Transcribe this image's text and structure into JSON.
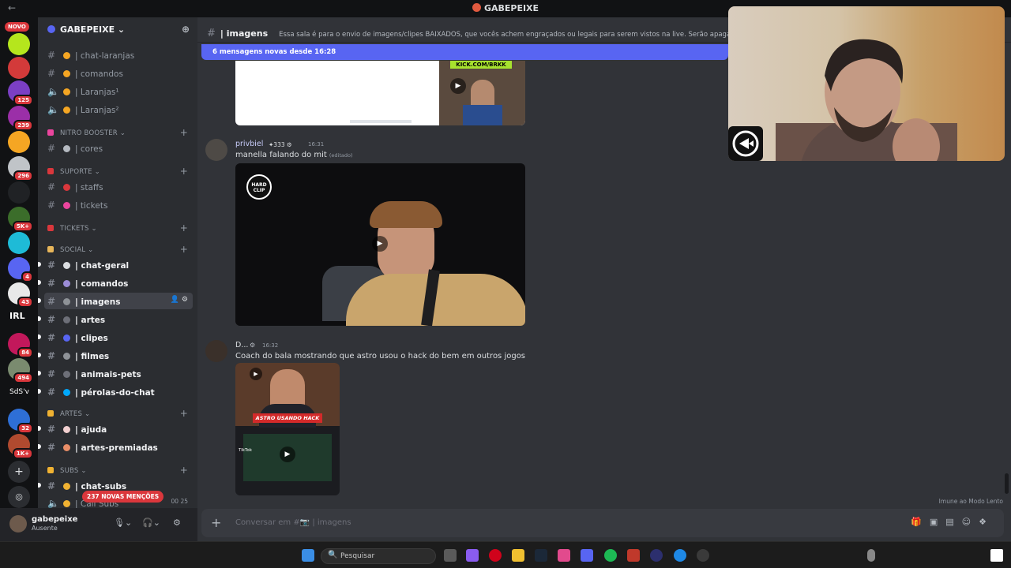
{
  "window": {
    "title": "GABEPEIXE",
    "back_label": "←"
  },
  "rail": {
    "novo_label": "NOVO",
    "servers": [
      {
        "name": "server-lime",
        "badge": "",
        "color": "#b5e61d"
      },
      {
        "name": "server-red-logo",
        "badge": "",
        "color": "#d33a3a"
      },
      {
        "name": "server-purple-1",
        "badge": "125",
        "color": "#7b3fc4"
      },
      {
        "name": "server-purple-2",
        "badge": "239",
        "color": "#9b2fa8"
      },
      {
        "name": "server-emoji",
        "badge": "",
        "color": "#f5a623"
      },
      {
        "name": "server-face",
        "badge": "296",
        "color": "#c0c4c8"
      },
      {
        "name": "server-diamond",
        "badge": "",
        "color": "#202225"
      },
      {
        "name": "server-frog",
        "badge": "5K+",
        "color": "#3b6d2a"
      },
      {
        "name": "server-rsmp",
        "badge": "",
        "color": "#1ebbd7"
      },
      {
        "name": "server-space",
        "badge": "4",
        "color": "#5865f2"
      },
      {
        "name": "server-white",
        "badge": "43",
        "color": "#e8e8e8"
      },
      {
        "name": "server-irl",
        "badge": "",
        "color": "#111214"
      },
      {
        "name": "server-pink",
        "badge": "84",
        "color": "#c2185b"
      },
      {
        "name": "server-anime",
        "badge": "494",
        "color": "#7a8b6f"
      },
      {
        "name": "server-sdsv",
        "badge": "",
        "color": "#111214"
      },
      {
        "name": "server-blue",
        "badge": "32",
        "color": "#2e6fd6"
      },
      {
        "name": "server-art",
        "badge": "1K+",
        "color": "#b04a2f"
      }
    ],
    "irl_label": "IRL",
    "sdsv_label": "SdS'v"
  },
  "sidebar": {
    "guild_name": "GABEPEIXE ⌄",
    "channels_top": [
      {
        "label": "| chat-laranjas"
      },
      {
        "label": "| comandos"
      },
      {
        "label": "| Laranjas¹"
      },
      {
        "label": "| Laranjas²"
      }
    ],
    "cat_nitro": "NITRO BOOSTER ⌄",
    "ch_cores": "| cores",
    "cat_suporte": "SUPORTE ⌄",
    "ch_staffs": "| staffs",
    "ch_tickets": "| tickets",
    "cat_tickets": "TICKETS ⌄",
    "cat_social": "SOCIAL ⌄",
    "social_channels": [
      {
        "label": "| chat-geral"
      },
      {
        "label": "| comandos"
      },
      {
        "label": "| imagens"
      },
      {
        "label": "| artes"
      },
      {
        "label": "| clipes"
      },
      {
        "label": "| filmes"
      },
      {
        "label": "| animais-pets"
      },
      {
        "label": "| pérolas-do-chat"
      }
    ],
    "cat_artes": "ARTES ⌄",
    "ch_ajuda": "| ajuda",
    "ch_artes_premiadas": "| artes-premiadas",
    "cat_subs": "SUBS ⌄",
    "ch_chat_subs": "| chat-subs",
    "ch_call_subs": "| Call Subs",
    "call_counts": "00  25",
    "mentions": "237 NOVAS MENÇÕES"
  },
  "user": {
    "name": "gabepeixe",
    "status": "Ausente"
  },
  "chat": {
    "channel": "| imagens",
    "topic": "Essa sala é para o envio de imagens/clipes BAIXADOS, que vocês achem engraçados ou legais para serem vistos na live. Serão apagados print",
    "new_messages": "6 mensagens novas desde 16:28",
    "embed1_banner": "KICK.COM/BRKK",
    "msg1": {
      "author": "privbiel",
      "tag": "333",
      "time": "16:31",
      "text": "manella falando do mit",
      "edited": "(editado)"
    },
    "embed2_logo": "HARD CLIP",
    "msg2": {
      "author": "D...",
      "time": "16:32",
      "text": "Coach do bala mostrando que astro usou o hack do bem em outros jogos"
    },
    "embed3_caption": "ASTRO USANDO HACK",
    "embed3_tiktok": "TikTok",
    "slowmode": "Imune ao Modo Lento",
    "placeholder": "Conversar em #📷 | imagens"
  },
  "taskbar": {
    "search_placeholder": "Pesquisar"
  }
}
